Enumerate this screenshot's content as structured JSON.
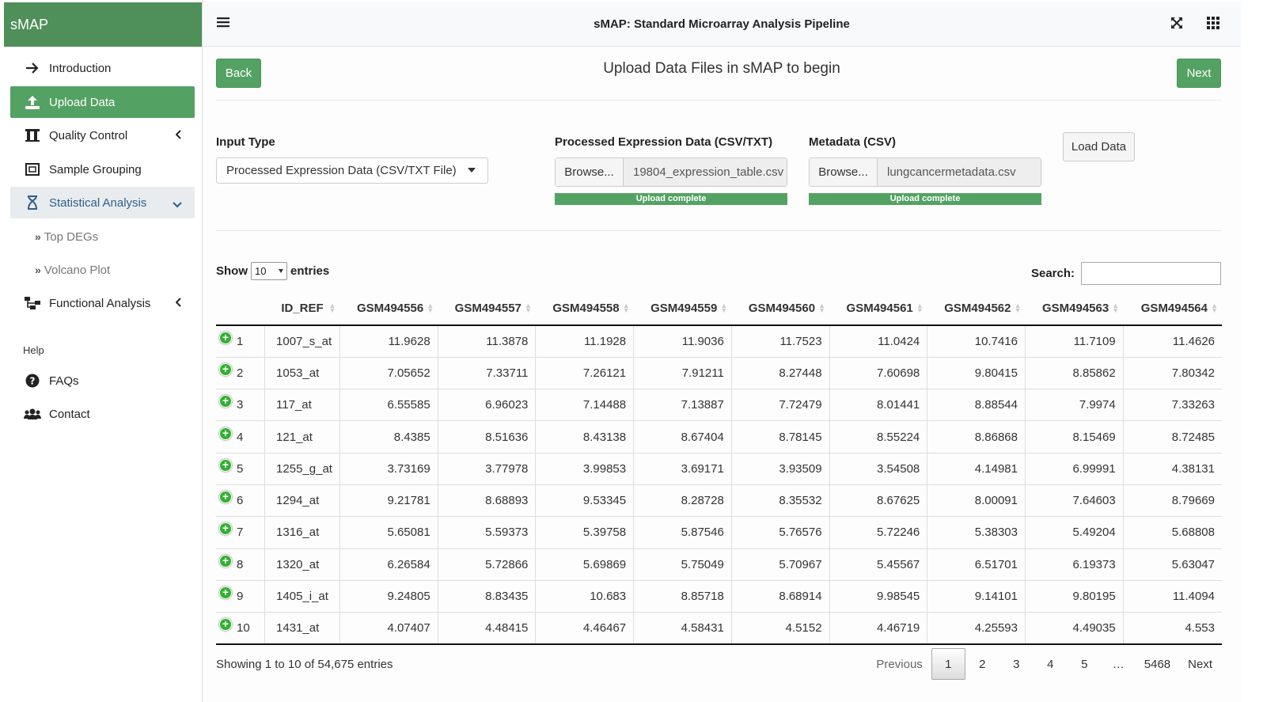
{
  "brand": "sMAP",
  "header": {
    "title": "sMAP: Standard Microarray Analysis Pipeline"
  },
  "sidebar": {
    "items": [
      {
        "label": "Introduction",
        "icon": "arrow-right-icon"
      },
      {
        "label": "Upload Data",
        "icon": "upload-icon"
      },
      {
        "label": "Quality Control",
        "icon": "quality-control-icon"
      },
      {
        "label": "Sample Grouping",
        "icon": "sample-grouping-icon"
      },
      {
        "label": "Statistical Analysis",
        "icon": "hourglass-icon"
      },
      {
        "label": "Functional Analysis",
        "icon": "sitemap-icon"
      }
    ],
    "sub_items": [
      "Top DEGs",
      "Volcano Plot"
    ],
    "help_label": "Help",
    "help_items": [
      {
        "label": "FAQs",
        "icon": "question-circle-icon"
      },
      {
        "label": "Contact",
        "icon": "users-icon"
      }
    ]
  },
  "main": {
    "back_label": "Back",
    "next_label": "Next",
    "heading": "Upload Data Files in sMAP to begin",
    "input_type": {
      "label": "Input Type",
      "value": "Processed Expression Data (CSV/TXT File)"
    },
    "expression_upload": {
      "label": "Processed Expression Data (CSV/TXT)",
      "browse": "Browse...",
      "file": "19804_expression_table.csv",
      "progress_text": "Upload complete",
      "progress": 1.0
    },
    "metadata_upload": {
      "label": "Metadata (CSV)",
      "browse": "Browse...",
      "file": "lungcancermetadata.csv",
      "progress_text": "Upload complete",
      "progress": 1.0
    },
    "load_label": "Load Data"
  },
  "table": {
    "show_label": "Show",
    "entries_value": "10",
    "entries_label": "entries",
    "search_label": "Search:",
    "columns": [
      "",
      "ID_REF",
      "GSM494556",
      "GSM494557",
      "GSM494558",
      "GSM494559",
      "GSM494560",
      "GSM494561",
      "GSM494562",
      "GSM494563",
      "GSM494564"
    ],
    "rows": [
      [
        "1",
        "1007_s_at",
        "11.9628",
        "11.3878",
        "11.1928",
        "11.9036",
        "11.7523",
        "11.0424",
        "10.7416",
        "11.7109",
        "11.4626"
      ],
      [
        "2",
        "1053_at",
        "7.05652",
        "7.33711",
        "7.26121",
        "7.91211",
        "8.27448",
        "7.60698",
        "9.80415",
        "8.85862",
        "7.80342"
      ],
      [
        "3",
        "117_at",
        "6.55585",
        "6.96023",
        "7.14488",
        "7.13887",
        "7.72479",
        "8.01441",
        "8.88544",
        "7.9974",
        "7.33263"
      ],
      [
        "4",
        "121_at",
        "8.4385",
        "8.51636",
        "8.43138",
        "8.67404",
        "8.78145",
        "8.55224",
        "8.86868",
        "8.15469",
        "8.72485"
      ],
      [
        "5",
        "1255_g_at",
        "3.73169",
        "3.77978",
        "3.99853",
        "3.69171",
        "3.93509",
        "3.54508",
        "4.14981",
        "6.99991",
        "4.38131"
      ],
      [
        "6",
        "1294_at",
        "9.21781",
        "8.68893",
        "9.53345",
        "8.28728",
        "8.35532",
        "8.67625",
        "8.00091",
        "7.64603",
        "8.79669"
      ],
      [
        "7",
        "1316_at",
        "5.65081",
        "5.59373",
        "5.39758",
        "5.87546",
        "5.76576",
        "5.72246",
        "5.38303",
        "5.49204",
        "5.68808"
      ],
      [
        "8",
        "1320_at",
        "6.26584",
        "5.72866",
        "5.69869",
        "5.75049",
        "5.70967",
        "5.45567",
        "6.51701",
        "6.19373",
        "5.63047"
      ],
      [
        "9",
        "1405_i_at",
        "9.24805",
        "8.83435",
        "10.683",
        "8.85718",
        "8.68914",
        "9.98545",
        "9.14101",
        "9.80195",
        "11.4094"
      ],
      [
        "10",
        "1431_at",
        "4.07407",
        "4.48415",
        "4.46467",
        "4.58431",
        "4.5152",
        "4.46719",
        "4.25593",
        "4.49035",
        "4.553"
      ]
    ],
    "info": "Showing 1 to 10 of 54,675 entries",
    "pagination": [
      "Previous",
      "1",
      "2",
      "3",
      "4",
      "5",
      "…",
      "5468",
      "Next"
    ],
    "current_page": "1"
  },
  "colors": {
    "brand": "#4e8f5a",
    "accent": "#54a263",
    "active_sub": "#2e5f8a"
  }
}
